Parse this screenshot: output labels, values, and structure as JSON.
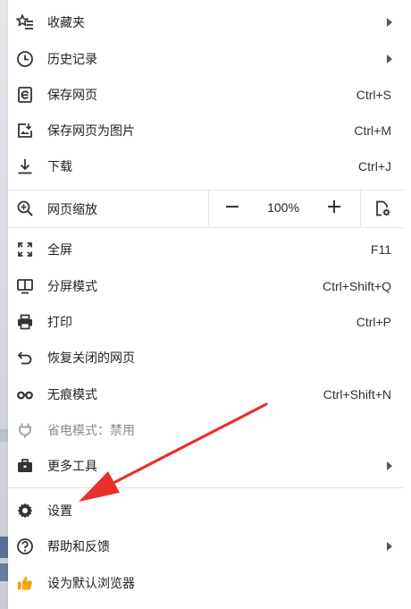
{
  "menu": {
    "items": [
      {
        "label": "收藏夹",
        "icon": "star-list-icon",
        "submenu": true
      },
      {
        "label": "历史记录",
        "icon": "clock-icon",
        "submenu": true
      },
      {
        "label": "保存网页",
        "icon": "save-page-icon",
        "shortcut": "Ctrl+S"
      },
      {
        "label": "保存网页为图片",
        "icon": "save-image-icon",
        "shortcut": "Ctrl+M"
      },
      {
        "label": "下载",
        "icon": "download-icon",
        "shortcut": "Ctrl+J"
      },
      {
        "label": "全屏",
        "icon": "fullscreen-icon",
        "shortcut": "F11"
      },
      {
        "label": "分屏模式",
        "icon": "split-screen-icon",
        "shortcut": "Ctrl+Shift+Q"
      },
      {
        "label": "打印",
        "icon": "printer-icon",
        "shortcut": "Ctrl+P"
      },
      {
        "label": "恢复关闭的网页",
        "icon": "undo-icon"
      },
      {
        "label": "无痕模式",
        "icon": "incognito-icon",
        "shortcut": "Ctrl+Shift+N"
      },
      {
        "label": "省电模式：禁用",
        "icon": "power-plug-icon",
        "disabled": true
      },
      {
        "label": "更多工具",
        "icon": "toolbox-icon",
        "submenu": true
      },
      {
        "label": "设置",
        "icon": "gear-icon"
      },
      {
        "label": "帮助和反馈",
        "icon": "help-icon",
        "submenu": true
      },
      {
        "label": "设为默认浏览器",
        "icon": "thumbs-up-icon"
      }
    ],
    "zoom": {
      "label": "网页缩放",
      "minus": "−",
      "value": "100%",
      "plus": "+"
    }
  },
  "colors": {
    "annotation_arrow": "#e8302a",
    "thumbs_up": "#f2a400",
    "separator": "#e2e2e2"
  }
}
